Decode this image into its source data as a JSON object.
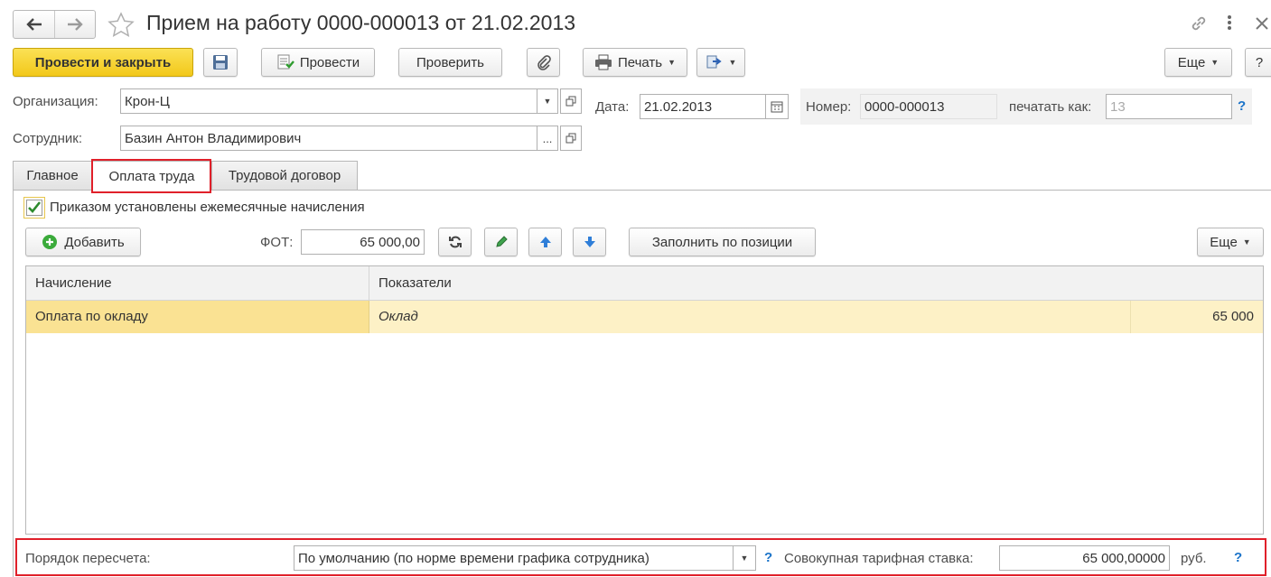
{
  "window": {
    "title": "Прием на работу 0000-000013 от 21.02.2013",
    "back_icon": "arrow-left-icon",
    "forward_icon": "arrow-right-icon",
    "favorite_icon": "star-icon",
    "link_icon": "link-icon",
    "more_icon": "vertical-dots-icon",
    "close_icon": "close-icon"
  },
  "toolbar": {
    "post_close_label": "Провести и закрыть",
    "save_icon": "floppy-disk-icon",
    "post_label": "Провести",
    "check_label": "Проверить",
    "attach_icon": "paperclip-icon",
    "print_label": "Печать",
    "more_label": "Еще",
    "help_label": "?"
  },
  "header": {
    "org_label": "Организация:",
    "org_value": "Крон-Ц",
    "date_label": "Дата:",
    "date_value": "21.02.2013",
    "number_label": "Номер:",
    "number_value": "0000-000013",
    "print_as_label": "печатать как:",
    "print_as_value": "13",
    "help_mark": "?",
    "employee_label": "Сотрудник:",
    "employee_value": "Базин Антон Владимирович",
    "select_dots": "..."
  },
  "tabs": [
    {
      "label": "Главное"
    },
    {
      "label": "Оплата труда"
    },
    {
      "label": "Трудовой договор"
    }
  ],
  "payroll": {
    "monthly_checkbox_label": "Приказом установлены ежемесячные начисления",
    "monthly_checked": true,
    "add_label": "Добавить",
    "fot_label": "ФОТ:",
    "fot_value": "65 000,00",
    "fill_position_label": "Заполнить по позиции",
    "more_label": "Еще",
    "table": {
      "columns": [
        "Начисление",
        "Показатели"
      ],
      "rows": [
        {
          "accrual": "Оплата по окладу",
          "indicator": "Оклад",
          "value": "65 000"
        }
      ]
    },
    "recalc_label": "Порядок пересчета:",
    "recalc_value": "По умолчанию (по норме времени графика сотрудника)",
    "total_rate_label": "Совокупная тарифная ставка:",
    "total_rate_value": "65 000,00000",
    "currency": "руб.",
    "help_mark": "?"
  },
  "colors": {
    "accent_button": "#f5d023",
    "selected_row": "#fae293",
    "selected_row_light": "#fdf1c6",
    "highlight_box": "#e0202a",
    "help": "#1a73c9"
  }
}
